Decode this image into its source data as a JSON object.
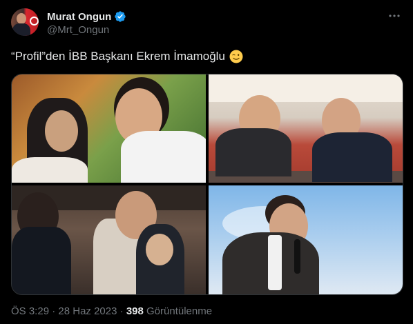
{
  "author": {
    "display_name": "Murat Ongun",
    "handle": "@Mrt_Ongun",
    "verified_icon": "verified-badge-icon"
  },
  "tweet": {
    "text": "“Profil”den İBB Başkanı Ekrem İmamoğlu",
    "emoji": "winking-face-emoji"
  },
  "meta": {
    "time": "ÖS 3:29",
    "separator": "·",
    "date": "28 Haz 2023",
    "views_count": "398",
    "views_label": "Görüntülenme"
  },
  "colors": {
    "background": "#000000",
    "text_primary": "#e7e9ea",
    "text_secondary": "#71767b",
    "verified_blue": "#1d9bf0",
    "border": "#2f3336"
  }
}
